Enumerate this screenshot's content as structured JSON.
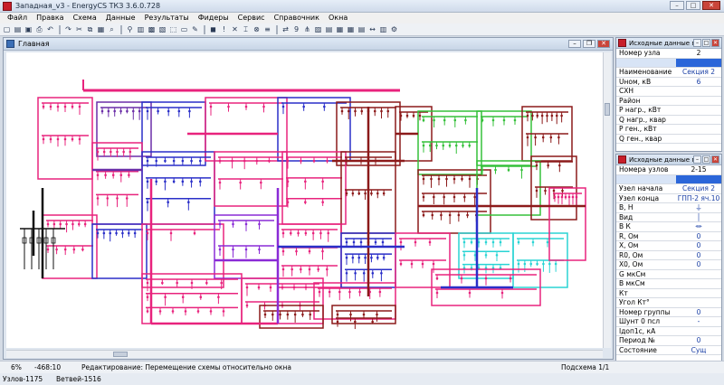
{
  "window": {
    "title": "Западная_v3 - EnergyCS ТКЗ 3.6.0.728"
  },
  "menu": [
    "Файл",
    "Правка",
    "Схема",
    "Данные",
    "Результаты",
    "Фидеры",
    "Сервис",
    "Справочник",
    "Окна"
  ],
  "toolbar": {
    "icons": [
      "new-file-icon",
      "open-icon",
      "save-icon",
      "print-icon",
      "undo-icon",
      "redo-icon",
      "cut-icon",
      "copy-icon",
      "paste-icon",
      "binoculars-icon",
      "find-icon",
      "layers-icon",
      "grid-icon",
      "scale-icon",
      "select-icon",
      "rect-icon",
      "pen-icon",
      "color-icon",
      "info-icon",
      "breaker-icon",
      "switch-icon",
      "transformer-icon",
      "line-icon",
      "swap-icon",
      "nine-icon",
      "tree-icon",
      "image-icon",
      "doc-icon",
      "calc-icon",
      "table-icon",
      "report-icon",
      "arrows-icon",
      "chart-icon",
      "settings-icon"
    ]
  },
  "main_window": {
    "title": "Главная"
  },
  "node_panel": {
    "title": "Исходные данные по...",
    "rows": [
      {
        "k": "Номер узла",
        "v": "2"
      },
      {
        "k": "",
        "v": "",
        "highlight": true
      },
      {
        "k": "Наименование",
        "v": "Секция 2"
      },
      {
        "k": "Uном,  кВ",
        "v": "6"
      },
      {
        "k": "СХН",
        "v": ""
      },
      {
        "k": "Район",
        "v": ""
      },
      {
        "k": "P нагр.,  кВт",
        "v": ""
      },
      {
        "k": "Q нагр.,  квар",
        "v": ""
      },
      {
        "k": "P ген.,  кВт",
        "v": ""
      },
      {
        "k": "Q ген.,  квар",
        "v": ""
      }
    ]
  },
  "branch_panel": {
    "title": "Исходные данные по...",
    "rows": [
      {
        "k": "Номера узлов",
        "v": "2-15"
      },
      {
        "k": "",
        "v": "",
        "highlight": true
      },
      {
        "k": "Узел начала",
        "v": "Секция 2"
      },
      {
        "k": "Узел конца",
        "v": "ГПП-2 яч.10"
      },
      {
        "k": "В,  Н",
        "v": "⏚"
      },
      {
        "k": "Вид",
        "v": "│"
      },
      {
        "k": "В К",
        "v": "⏛"
      },
      {
        "k": "R,  Ом",
        "v": "0"
      },
      {
        "k": "X,  Ом",
        "v": "0"
      },
      {
        "k": "R0,  Ом",
        "v": "0"
      },
      {
        "k": "X0,  Ом",
        "v": "0"
      },
      {
        "k": "G мкСм",
        "v": ""
      },
      {
        "k": "B мкСм",
        "v": ""
      },
      {
        "k": "Кт",
        "v": ""
      },
      {
        "k": "Угол Кт°",
        "v": ""
      },
      {
        "k": "Номер группы",
        "v": "0"
      },
      {
        "k": "Шунт 0 псл",
        "v": "-"
      },
      {
        "k": "Iдоп1с,  кА",
        "v": ""
      },
      {
        "k": "Период  №",
        "v": "0"
      },
      {
        "k": "Состояние",
        "v": "Сущ"
      }
    ]
  },
  "status": {
    "zoom": "6%",
    "coords": "-468:10",
    "mode": "Редактирование: Перемещение схемы относительно окна",
    "subscheme": "Подсхема 1/1"
  },
  "summary": {
    "nodes": "Узлов-1175",
    "branches": "Ветвей-1516"
  },
  "colors": {
    "pink": "#e8237d",
    "blue": "#2a2fc8",
    "purple": "#8a2bd6",
    "dark_red": "#8c1a1a",
    "green": "#35c03a",
    "cyan": "#2ad4d4",
    "violet": "#6b2ea8",
    "black": "#111111"
  }
}
